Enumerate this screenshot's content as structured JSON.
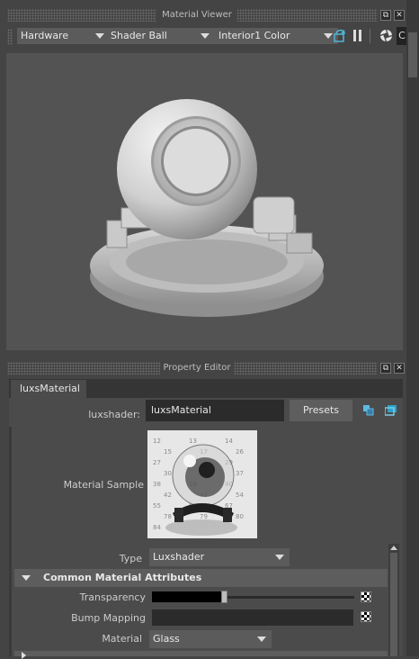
{
  "material_viewer": {
    "title": "Material Viewer",
    "renderer": "Hardware",
    "shape": "Shader Ball",
    "environment": "Interior1 Color"
  },
  "property_editor": {
    "title": "Property Editor",
    "tab": "luxsMaterial",
    "node_label": "luxshader:",
    "node_value": "luxsMaterial",
    "presets_label": "Presets",
    "material_sample_label": "Material Sample",
    "type_label": "Type",
    "type_value": "Luxshader",
    "section_title": "Common Material Attributes",
    "transparency_label": "Transparency",
    "transparency_value": 0.34,
    "bump_mapping_label": "Bump Mapping",
    "material_label": "Material",
    "material_value": "Glass"
  },
  "sample_numbers": [
    "12",
    "13",
    "14",
    "15",
    "17",
    "26",
    "27",
    "28",
    "29",
    "30",
    "31",
    "37",
    "38",
    "39",
    "40",
    "42",
    "43",
    "54",
    "55",
    "58",
    "67",
    "78",
    "79",
    "80",
    "84",
    "86",
    "90"
  ],
  "icons": [
    "dock-float-icon",
    "close-icon",
    "refresh-icon",
    "pause-icon",
    "aperture-icon",
    "lock-icon"
  ]
}
